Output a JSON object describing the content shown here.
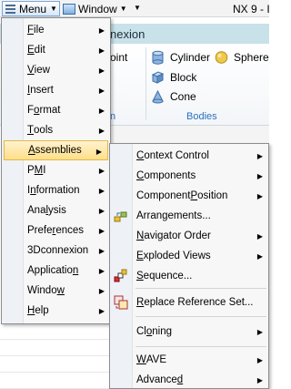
{
  "topbar": {
    "menu_label": "Menu",
    "window_label": "Window",
    "app_title": "NX 9 - I"
  },
  "ribbon": {
    "tab_partial": "nexion",
    "point_partial": "oint",
    "items": [
      {
        "label": "Cylinder",
        "icon": "cylinder-icon"
      },
      {
        "label": "Sphere",
        "icon": "sphere-icon"
      },
      {
        "label": "Block",
        "icon": "block-icon"
      },
      {
        "label": "Cone",
        "icon": "cone-icon"
      }
    ],
    "group_label": "Bodies",
    "group_partial": "n"
  },
  "menu": {
    "items": [
      {
        "pre": "",
        "u": "F",
        "post": "ile"
      },
      {
        "pre": "",
        "u": "E",
        "post": "dit"
      },
      {
        "pre": "",
        "u": "V",
        "post": "iew"
      },
      {
        "pre": "",
        "u": "I",
        "post": "nsert"
      },
      {
        "pre": "F",
        "u": "o",
        "post": "rmat"
      },
      {
        "pre": "",
        "u": "T",
        "post": "ools"
      },
      {
        "pre": "",
        "u": "A",
        "post": "ssemblies"
      },
      {
        "pre": "P",
        "u": "M",
        "post": "I"
      },
      {
        "pre": "I",
        "u": "n",
        "post": "formation"
      },
      {
        "pre": "Ana",
        "u": "l",
        "post": "ysis"
      },
      {
        "pre": "Prefe",
        "u": "r",
        "post": "ences"
      },
      {
        "pre": "3Dconnexion",
        "u": "",
        "post": ""
      },
      {
        "pre": "Applicatio",
        "u": "n",
        "post": ""
      },
      {
        "pre": "Windo",
        "u": "w",
        "post": ""
      },
      {
        "pre": "",
        "u": "H",
        "post": "elp"
      }
    ]
  },
  "submenu": {
    "items": [
      {
        "pre": "",
        "u": "C",
        "post": "ontext Control"
      },
      {
        "pre": "",
        "u": "C",
        "post": "omponents"
      },
      {
        "pre": "Component ",
        "u": "P",
        "post": "osition"
      },
      {
        "pre": "Arrangements...",
        "u": "",
        "post": ""
      },
      {
        "pre": "",
        "u": "N",
        "post": "avigator Order"
      },
      {
        "pre": "",
        "u": "E",
        "post": "xploded Views"
      },
      {
        "pre": "",
        "u": "S",
        "post": "equence..."
      },
      {
        "pre": "",
        "u": "R",
        "post": "eplace Reference Set..."
      },
      {
        "pre": "Cl",
        "u": "o",
        "post": "ning"
      },
      {
        "pre": "",
        "u": "W",
        "post": "AVE"
      },
      {
        "pre": "Advance",
        "u": "d",
        "post": ""
      }
    ]
  },
  "colors": {
    "highlight": "#ffdf8a",
    "accent_blue": "#2a6fbf",
    "ribbon_band": "#c9e1e8"
  }
}
